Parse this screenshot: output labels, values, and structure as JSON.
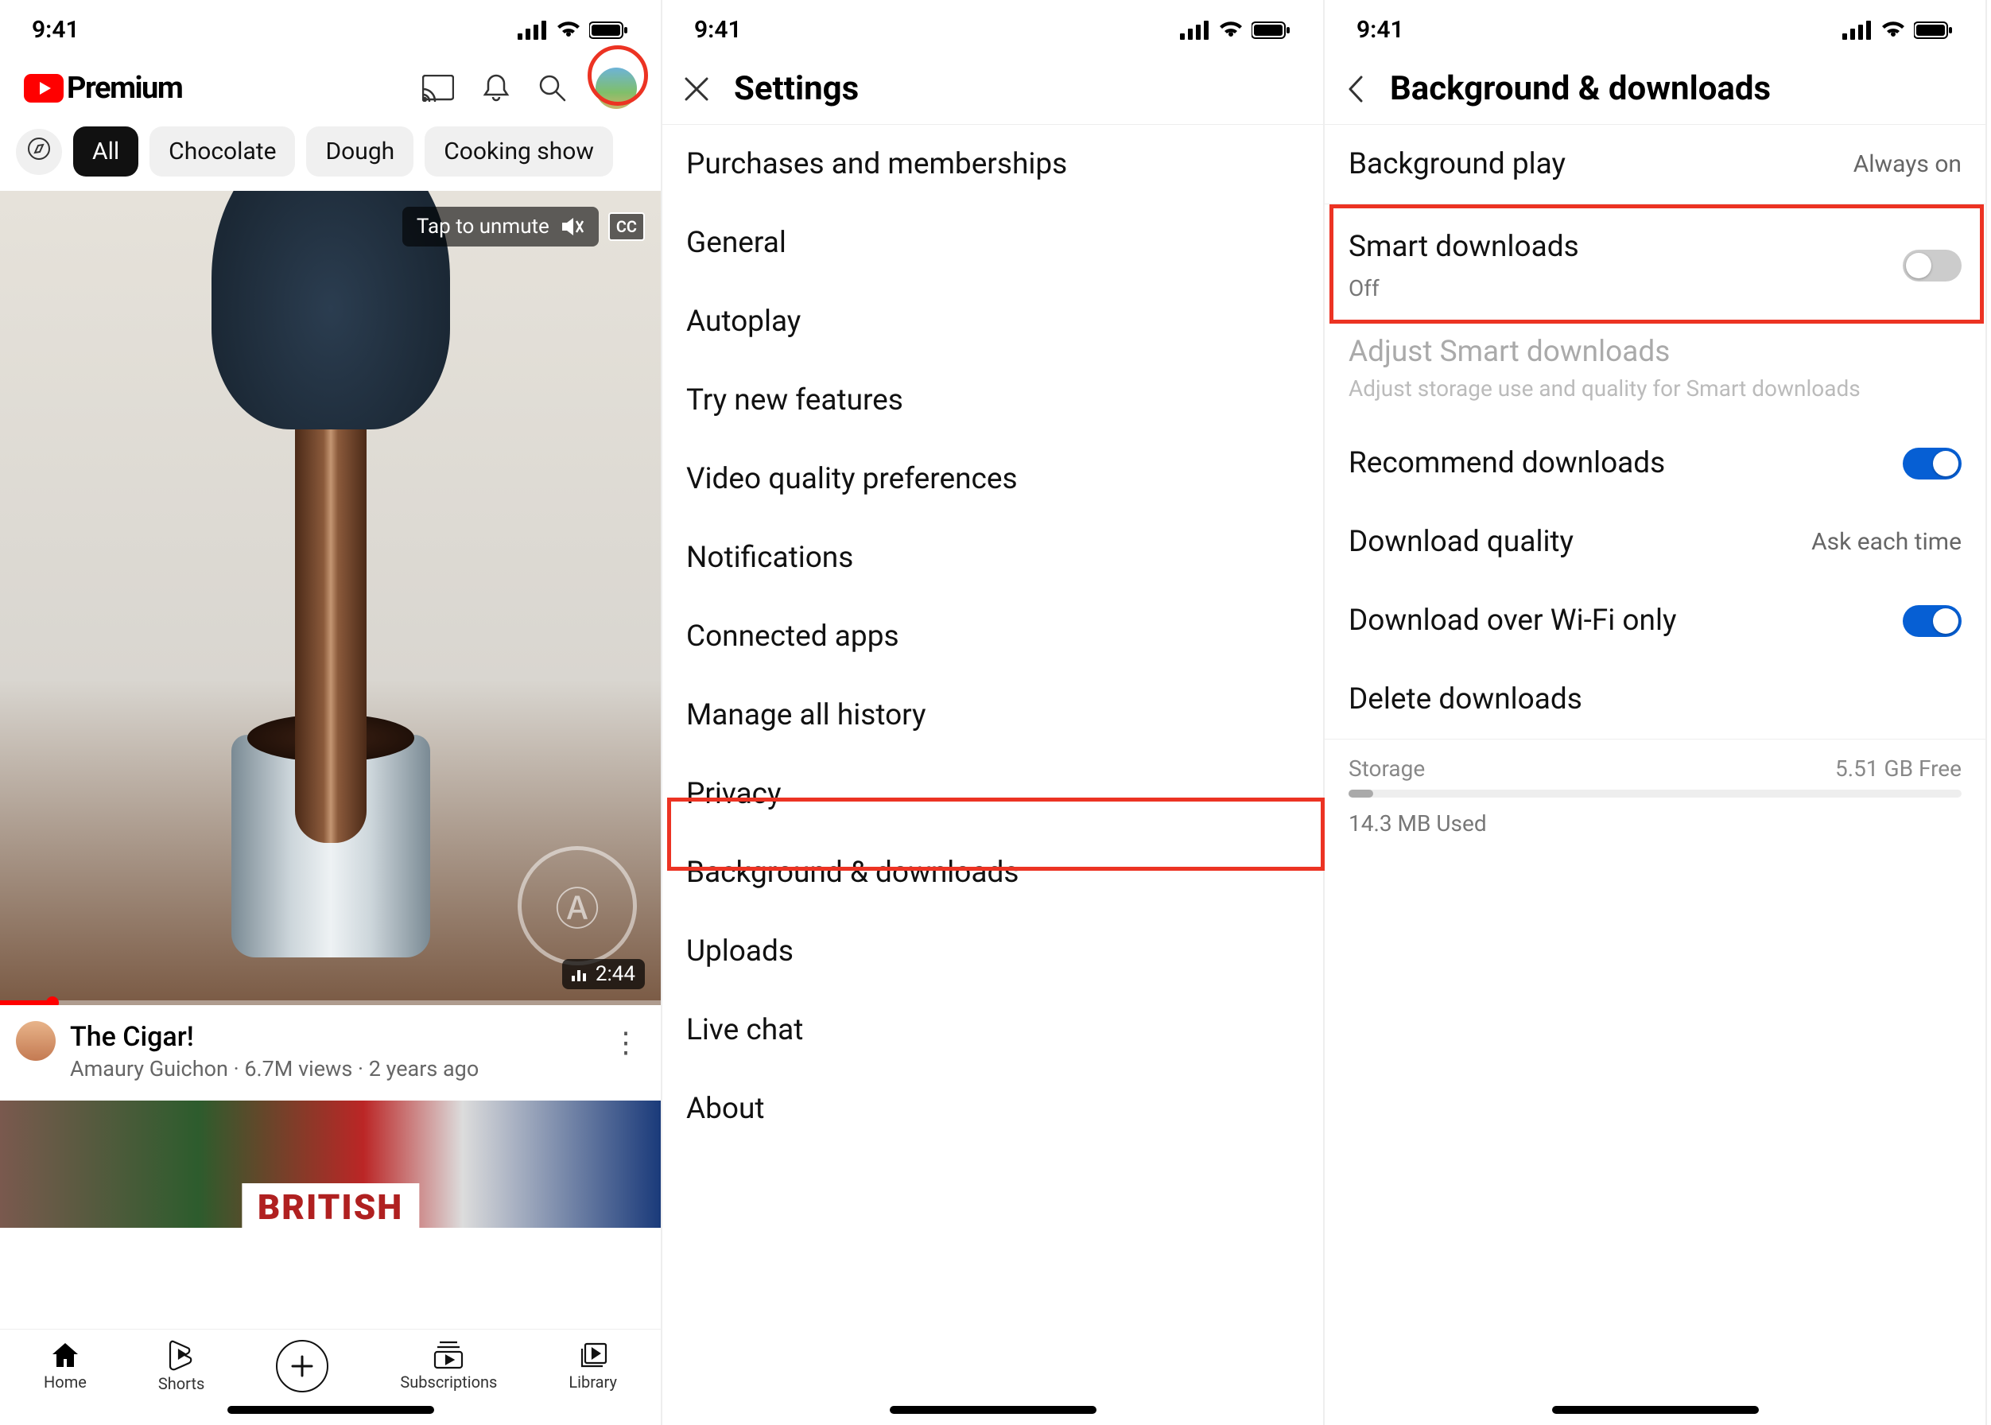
{
  "status": {
    "time": "9:41"
  },
  "panel1": {
    "logo": "Premium",
    "chips": [
      "All",
      "Chocolate",
      "Dough",
      "Cooking show"
    ],
    "unmute": "Tap to unmute",
    "cc": "CC",
    "video_duration": "2:44",
    "video_title": "The Cigar!",
    "video_channel": "Amaury Guichon",
    "video_views": "6.7M views",
    "video_age": "2 years ago",
    "thumb2_title": "BRITISH",
    "nav": {
      "home": "Home",
      "shorts": "Shorts",
      "subs": "Subscriptions",
      "library": "Library"
    }
  },
  "panel2": {
    "title": "Settings",
    "items": [
      "Purchases and memberships",
      "General",
      "Autoplay",
      "Try new features",
      "Video quality preferences",
      "Notifications",
      "Connected apps",
      "Manage all history",
      "Privacy",
      "Background & downloads",
      "Uploads",
      "Live chat",
      "About"
    ]
  },
  "panel3": {
    "title": "Background & downloads",
    "background_play": {
      "label": "Background play",
      "value": "Always on"
    },
    "smart_downloads": {
      "label": "Smart downloads",
      "status": "Off"
    },
    "adjust": {
      "label": "Adjust Smart downloads",
      "sub": "Adjust storage use and quality for Smart downloads"
    },
    "recommend": "Recommend downloads",
    "quality": {
      "label": "Download quality",
      "value": "Ask each time"
    },
    "wifi": "Download over Wi-Fi only",
    "delete": "Delete downloads",
    "storage": {
      "label": "Storage",
      "free": "5.51 GB Free",
      "used": "14.3 MB Used"
    }
  }
}
